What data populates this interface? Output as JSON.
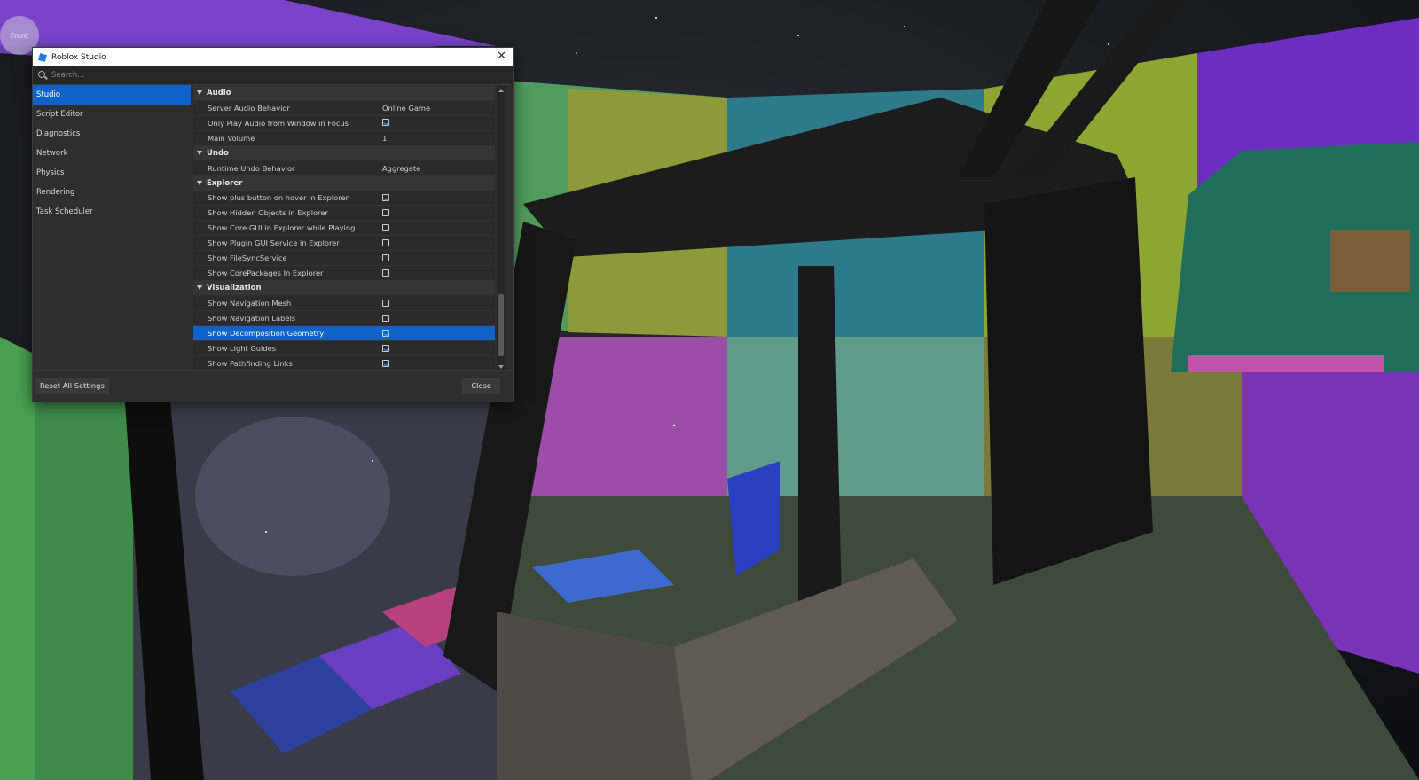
{
  "viewport": {
    "view_cube_label": "Front"
  },
  "dialog": {
    "title": "Roblox Studio",
    "search_placeholder": "Search...",
    "sidebar": {
      "items": [
        {
          "label": "Studio",
          "active": true
        },
        {
          "label": "Script Editor",
          "active": false
        },
        {
          "label": "Diagnostics",
          "active": false
        },
        {
          "label": "Network",
          "active": false
        },
        {
          "label": "Physics",
          "active": false
        },
        {
          "label": "Rendering",
          "active": false
        },
        {
          "label": "Task Scheduler",
          "active": false
        }
      ]
    },
    "groups": {
      "audio": {
        "title": "Audio",
        "server_audio_behavior": {
          "label": "Server Audio Behavior",
          "value": "Online Game"
        },
        "only_play_audio": {
          "label": "Only Play Audio from Window in Focus",
          "checked": true
        },
        "main_volume": {
          "label": "Main Volume",
          "value": "1"
        }
      },
      "undo": {
        "title": "Undo",
        "runtime_undo": {
          "label": "Runtime Undo Behavior",
          "value": "Aggregate"
        }
      },
      "explorer": {
        "title": "Explorer",
        "plus_button": {
          "label": "Show plus button on hover in Explorer",
          "checked": true
        },
        "hidden_objects": {
          "label": "Show Hidden Objects in Explorer",
          "checked": false
        },
        "core_gui": {
          "label": "Show Core GUI in Explorer while Playing",
          "checked": false
        },
        "plugin_gui": {
          "label": "Show Plugin GUI Service in Explorer",
          "checked": false
        },
        "filesync": {
          "label": "Show FileSyncService",
          "checked": false
        },
        "corepackages": {
          "label": "Show CorePackages In Explorer",
          "checked": false
        }
      },
      "visualization": {
        "title": "Visualization",
        "nav_mesh": {
          "label": "Show Navigation Mesh",
          "checked": false
        },
        "nav_labels": {
          "label": "Show Navigation Labels",
          "checked": false
        },
        "decomposition": {
          "label": "Show Decomposition Geometry",
          "checked": true,
          "selected": true
        },
        "light_guides": {
          "label": "Show Light Guides",
          "checked": true
        },
        "pathfinding": {
          "label": "Show Pathfinding Links",
          "checked": true
        }
      }
    },
    "footer": {
      "reset_label": "Reset All Settings",
      "close_label": "Close"
    },
    "colors": {
      "accent": "#0f62c8",
      "checkmark": "#37a1ff",
      "dialog_bg": "#2e2e2e"
    }
  }
}
